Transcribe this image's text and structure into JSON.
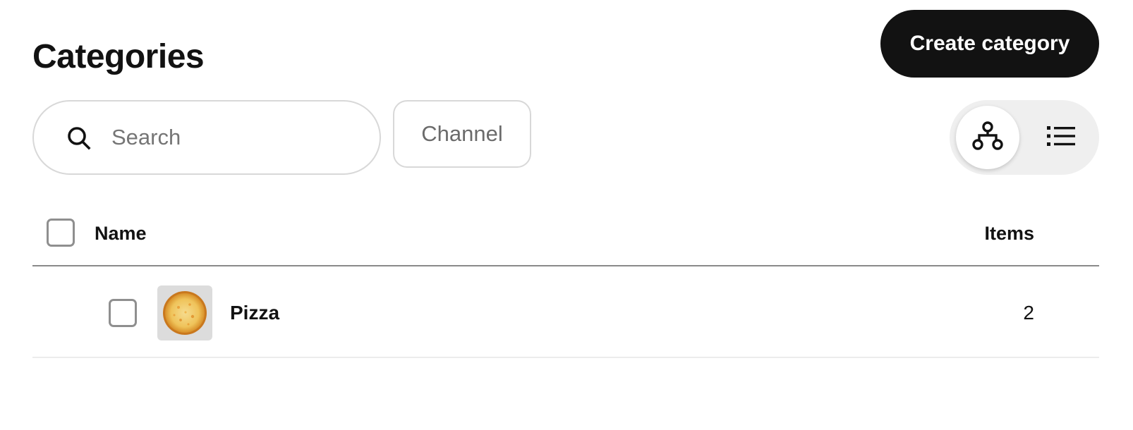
{
  "header": {
    "title": "Categories",
    "create_label": "Create category"
  },
  "toolbar": {
    "search_placeholder": "Search",
    "search_icon": "search-icon",
    "channel_label": "Channel",
    "view_toggle": {
      "selected": "tree",
      "options": [
        {
          "id": "tree",
          "icon": "hierarchy-icon"
        },
        {
          "id": "list",
          "icon": "list-icon"
        }
      ]
    }
  },
  "table": {
    "columns": {
      "name": "Name",
      "items": "Items"
    },
    "rows": [
      {
        "name": "Pizza",
        "items": "2",
        "thumbnail": "pizza-image"
      }
    ]
  },
  "colors": {
    "primary": "#121212",
    "border": "#d8d8d8",
    "toggle_bg": "#efefef",
    "thumb_bg": "#dcdcdc"
  }
}
